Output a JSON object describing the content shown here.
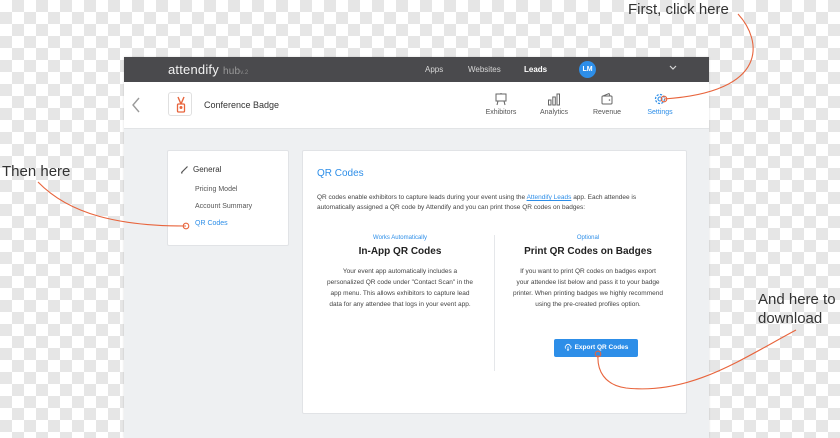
{
  "callouts": {
    "first": "First, click here",
    "then": "Then here",
    "download_line1": "And here to",
    "download_line2": "download"
  },
  "topbar": {
    "brand": "attendify",
    "hub": "hub",
    "version": "v.2",
    "nav": [
      "Apps",
      "Websites",
      "Leads"
    ],
    "avatar_initials": "LM"
  },
  "subheader": {
    "page_title": "Conference Badge",
    "tabs": [
      {
        "label": "Exhibitors",
        "icon": "easel-icon"
      },
      {
        "label": "Analytics",
        "icon": "bar-chart-icon"
      },
      {
        "label": "Revenue",
        "icon": "wallet-icon"
      },
      {
        "label": "Settings",
        "icon": "gear-icon"
      }
    ]
  },
  "sidebar": {
    "heading": "General",
    "items": [
      "Pricing Model",
      "Account Summary",
      "QR Codes"
    ]
  },
  "panel": {
    "title": "QR Codes",
    "desc_before": "QR codes enable exhibitors to capture leads during your event using the ",
    "desc_link": "Attendify Leads",
    "desc_after": " app. Each attendee is automatically assigned a QR code by Attendify and you can print those QR codes on badges:",
    "left": {
      "eyebrow": "Works Automatically",
      "title": "In-App QR Codes",
      "text": "Your event app automatically includes a personalized QR code under \"Contact Scan\" in the app menu. This allows exhibitors to capture lead data for any attendee that logs in your event app."
    },
    "right": {
      "eyebrow": "Optional",
      "title": "Print QR Codes on Badges",
      "text": "If you want to print QR codes on badges export your attendee list below and pass it to your badge printer. When printing badges we highly recommend using the pre-created profiles option.",
      "button": "Export QR Codes"
    }
  },
  "colors": {
    "accent": "#2d8ee8",
    "topbar": "#4a4a4d",
    "annotation": "#e8643c"
  }
}
